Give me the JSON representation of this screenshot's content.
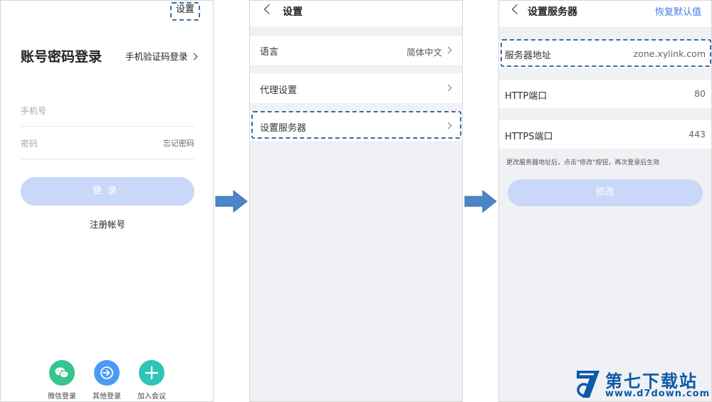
{
  "login_screen": {
    "settings_label": "设置",
    "title": "账号密码登录",
    "sms_login_link": "手机验证码登录",
    "phone_placeholder": "手机号",
    "password_placeholder": "密码",
    "forgot_password": "忘记密码",
    "login_button": "登录",
    "register_link": "注册帐号",
    "bottom_actions": [
      {
        "label": "微信登录",
        "icon": "wechat-icon",
        "color": "#36c48f"
      },
      {
        "label": "其他登录",
        "icon": "login-arrow-icon",
        "color": "#4a9bf5"
      },
      {
        "label": "加入会议",
        "icon": "plus-icon",
        "color": "#2ec4b6"
      }
    ]
  },
  "settings_screen": {
    "title": "设置",
    "items": [
      {
        "label": "语言",
        "value": "简体中文"
      },
      {
        "label": "代理设置",
        "value": ""
      },
      {
        "label": "设置服务器",
        "value": ""
      }
    ]
  },
  "server_screen": {
    "title": "设置服务器",
    "restore_default": "恢复默认值",
    "fields": [
      {
        "label": "服务器地址",
        "value": "zone.xylink.com"
      },
      {
        "label": "HTTP端口",
        "value": "80"
      },
      {
        "label": "HTTPS端口",
        "value": "443"
      }
    ],
    "hint": "更改服务器地址后，点击\"修改\"按钮，再次登录后生效",
    "modify_button": "修改"
  },
  "watermark": {
    "title": "第七下载站",
    "url": "www.d7down.com"
  },
  "colors": {
    "accent_blue": "#3f7de0",
    "disabled_button": "#c9d8f9",
    "highlight_dash": "#3f6aa8",
    "arrow_fill": "#4a86c8"
  }
}
